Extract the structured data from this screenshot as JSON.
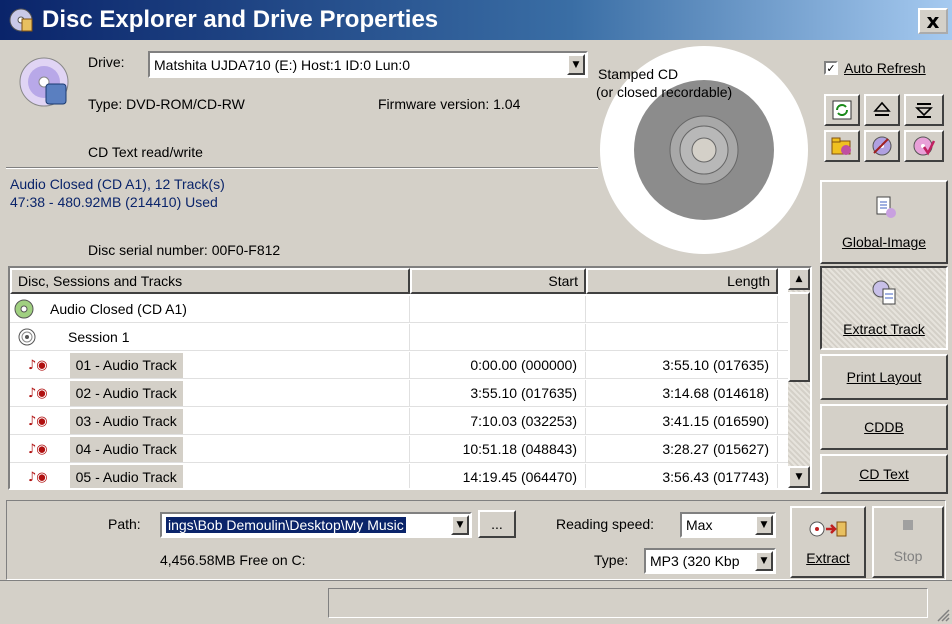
{
  "window": {
    "title": "Disc Explorer and Drive Properties",
    "close_label": "x"
  },
  "drive": {
    "label": "Drive:",
    "selected": "Matshita UJDA710 (E:) Host:1 ID:0 Lun:0",
    "type": "Type: DVD-ROM/CD-RW",
    "firmware": "Firmware version: 1.04",
    "cd_text": "CD Text read/write"
  },
  "disc": {
    "status_line1": "Audio Closed (CD A1), 12 Track(s)",
    "status_line2": "47:38 - 480.92MB (214410) Used",
    "serial": "Disc serial number:  00F0-F812",
    "image_label_line1": "Stamped CD",
    "image_label_line2": "(or closed recordable)"
  },
  "auto_refresh": {
    "label": "Auto Refresh",
    "checked": true
  },
  "icons": [
    "refresh-icon",
    "eject-icon",
    "close-tray-icon",
    "folder-icon",
    "burn-icon",
    "verify-icon"
  ],
  "table": {
    "columns": [
      "Disc, Sessions and Tracks",
      "Start",
      "Length"
    ],
    "disc_row": "Audio Closed (CD A1)",
    "session_row": "Session 1",
    "tracks": [
      {
        "name": "01 - Audio Track",
        "start": "0:00.00 (000000)",
        "length": "3:55.10 (017635)"
      },
      {
        "name": "02 - Audio Track",
        "start": "3:55.10 (017635)",
        "length": "3:14.68 (014618)"
      },
      {
        "name": "03 - Audio Track",
        "start": "7:10.03 (032253)",
        "length": "3:41.15 (016590)"
      },
      {
        "name": "04 - Audio Track",
        "start": "10:51.18 (048843)",
        "length": "3:28.27 (015627)"
      },
      {
        "name": "05 - Audio Track",
        "start": "14:19.45 (064470)",
        "length": "3:56.43 (017743)"
      }
    ]
  },
  "side_buttons": {
    "global_image": "Global-Image",
    "extract_track": "Extract Track",
    "print_layout": "Print Layout",
    "cddb": "CDDB",
    "cd_text": "CD Text"
  },
  "bottom": {
    "path_label": "Path:",
    "path_value": "ings\\Bob Demoulin\\Desktop\\My Music",
    "browse": "...",
    "free_space": "4,456.58MB Free on C:",
    "reading_speed_label": "Reading speed:",
    "reading_speed_value": "Max",
    "type_label": "Type:",
    "type_value": "MP3 (320 Kbp",
    "extract": "Extract",
    "stop": "Stop"
  }
}
